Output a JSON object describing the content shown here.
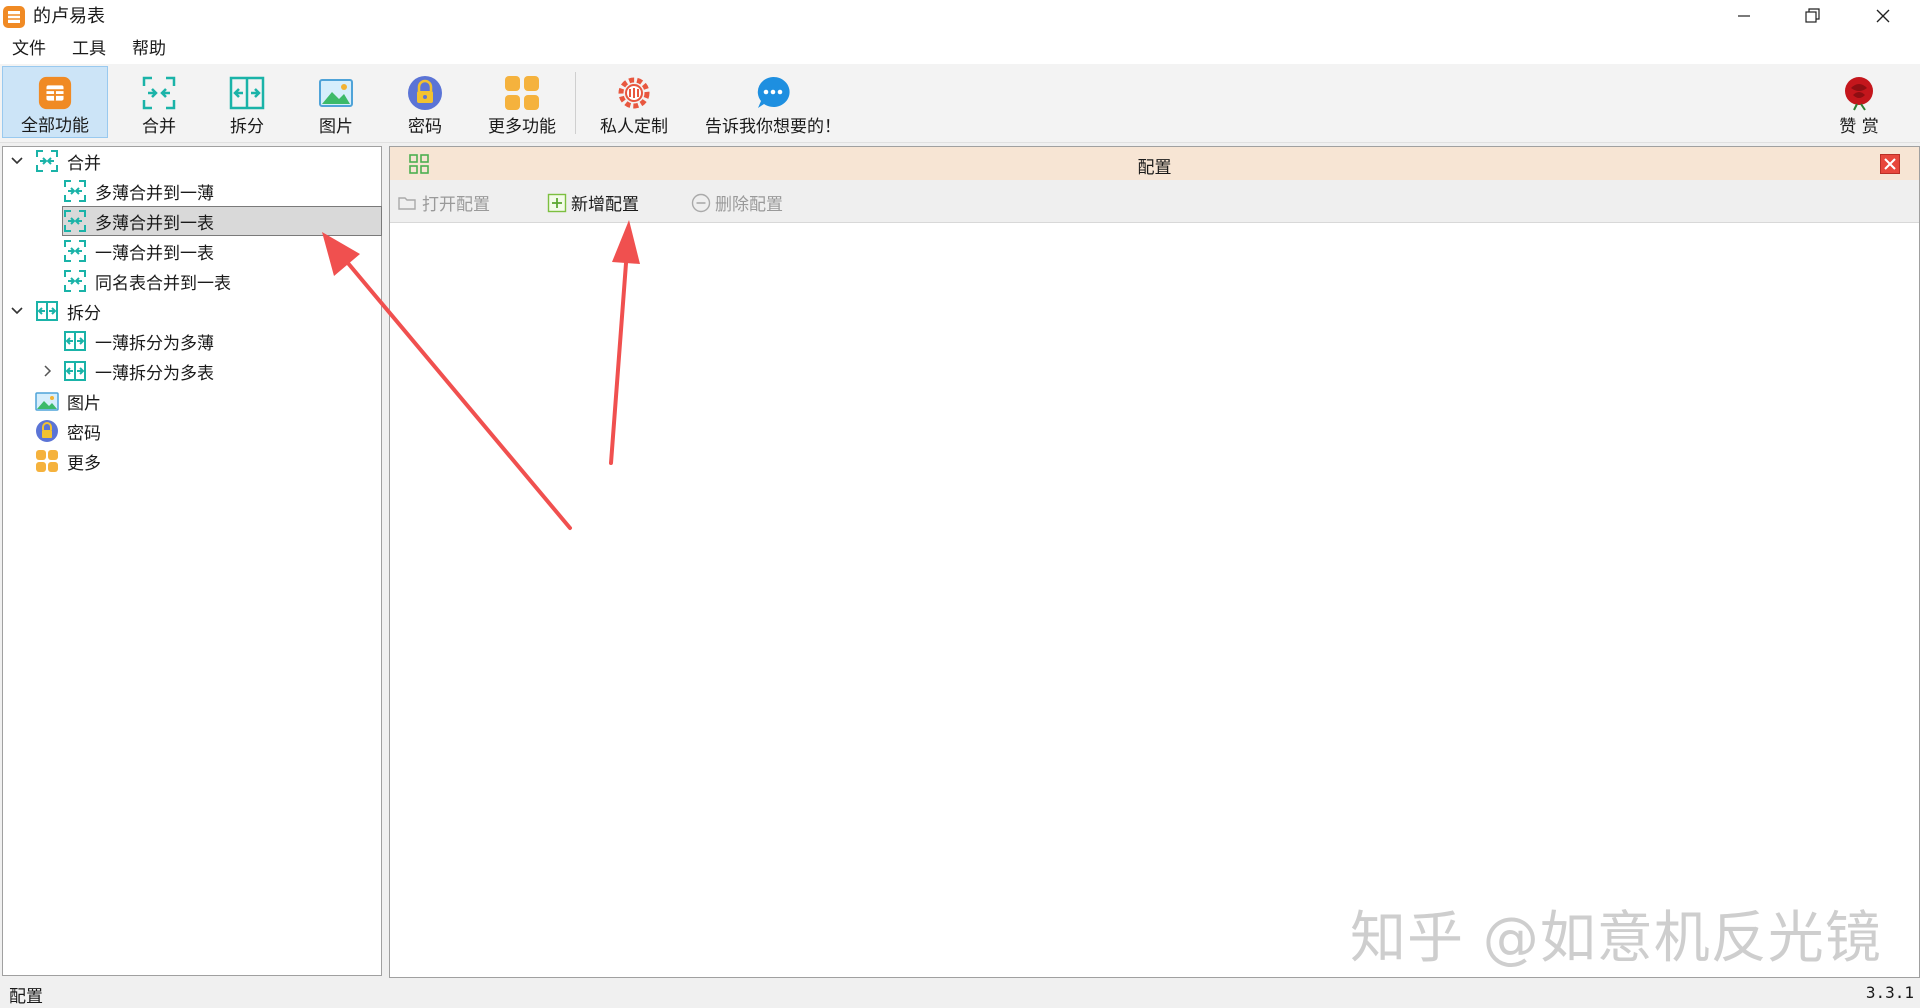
{
  "window": {
    "title": "的卢易表"
  },
  "menu": {
    "items": [
      "文件",
      "工具",
      "帮助"
    ]
  },
  "toolbar": {
    "buttons": [
      {
        "label": "全部功能",
        "icon": "grid-app-icon"
      },
      {
        "label": "合并",
        "icon": "merge-icon"
      },
      {
        "label": "拆分",
        "icon": "split-icon"
      },
      {
        "label": "图片",
        "icon": "picture-icon"
      },
      {
        "label": "密码",
        "icon": "lock-icon"
      },
      {
        "label": "更多功能",
        "icon": "more-functions-icon"
      },
      {
        "label": "私人定制",
        "icon": "customize-icon"
      },
      {
        "label": "告诉我你想要的！",
        "icon": "chat-bubble-icon"
      },
      {
        "label": "赞 赏",
        "icon": "rose-icon"
      }
    ]
  },
  "tree": {
    "items": [
      {
        "label": "合并",
        "level": 0,
        "expanded": true
      },
      {
        "label": "多薄合并到一薄",
        "level": 1
      },
      {
        "label": "多薄合并到一表",
        "level": 1,
        "selected": true
      },
      {
        "label": "一薄合并到一表",
        "level": 1
      },
      {
        "label": "同名表合并到一表",
        "level": 1
      },
      {
        "label": "拆分",
        "level": 0,
        "expanded": true
      },
      {
        "label": "一薄拆分为多薄",
        "level": 1
      },
      {
        "label": "一薄拆分为多表",
        "level": 1,
        "expandable": true
      },
      {
        "label": "图片",
        "level": 0
      },
      {
        "label": "密码",
        "level": 0
      },
      {
        "label": "更多",
        "level": 0
      }
    ]
  },
  "panel": {
    "title": "配置",
    "actions": {
      "open": "打开配置",
      "add": "新增配置",
      "delete": "删除配置"
    }
  },
  "watermark": "知乎 @如意机反光镜",
  "status": {
    "left": "配置",
    "version": "3.3.1"
  },
  "colors": {
    "accent_orange": "#f08a24",
    "teal": "#1ab3a8",
    "panel_header": "#f7e5d4",
    "close_red": "#e8473c",
    "arrow_red": "#f0504f"
  }
}
